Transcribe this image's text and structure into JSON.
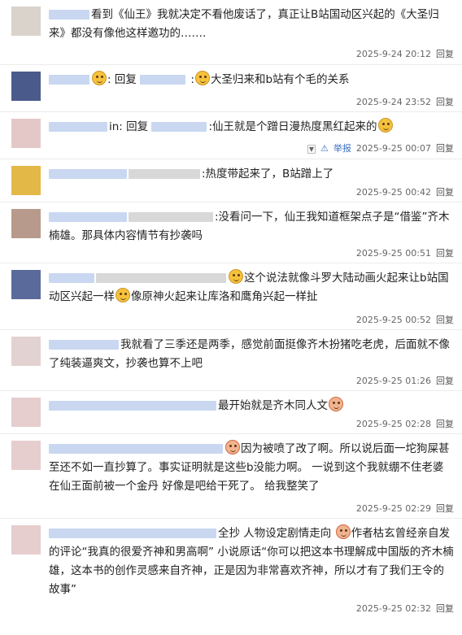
{
  "comments": [
    {
      "parts": [
        {
          "t": "看到《仙王》我就决定不看他废话了，真正让B站国动区兴起的《大圣归来》都没有像他这样邀功的……."
        }
      ],
      "time": "2025-9-24 20:12"
    },
    {
      "parts": [
        {
          "t": ": 回复 "
        },
        {
          "t": " :"
        },
        {
          "t": "大圣归来和b站有个毛的关系"
        }
      ],
      "time": "2025-9-24 23:52"
    },
    {
      "parts": [
        {
          "t": "in: 回复 "
        },
        {
          "t": ":仙王就是个蹭日漫热度黑红起来的"
        }
      ],
      "time": "2025-9-25 00:07",
      "report": "举报"
    },
    {
      "parts": [
        {
          "t": ":热度带起来了，B站蹭上了"
        }
      ],
      "time": "2025-9-25 00:42"
    },
    {
      "parts": [
        {
          "t": ":没看问一下，仙王我知道框架点子是“借鉴”齐木楠雄。那具体内容情节有抄袭吗"
        }
      ],
      "time": "2025-9-25 00:51"
    },
    {
      "parts": [
        {
          "t": "这个说法就像斗罗大陆动画火起来让b站国动区兴起一样"
        },
        {
          "t": "像原神火起来让库洛和鹰角兴起一样扯"
        }
      ],
      "time": "2025-9-25 00:52"
    },
    {
      "parts": [
        {
          "t": "我就看了三季还是两季，感觉前面挺像齐木扮猪吃老虎，后面就不像了纯装逼爽文，抄袭也算不上吧"
        }
      ],
      "time": "2025-9-25 01:26"
    },
    {
      "parts": [
        {
          "t": "最开始就是齐木同人文"
        }
      ],
      "time": "2025-9-25 02:28"
    },
    {
      "parts": [
        {
          "t": "因为被喷了改了啊。所以说后面一坨狗屎甚至还不如一直抄算了。事实证明就是这些b没能力啊。 一说到这个我就绷不住老婆在仙王面前被一个金丹 好像是吧给干死了。 给我整笑了"
        }
      ],
      "time": "2025-9-25 02:29"
    },
    {
      "parts": [
        {
          "t": "全抄 人物设定剧情走向 "
        },
        {
          "t": "作者枯玄曾经亲自发的评论“我真的很爱齐神和男高啊” 小说原话“你可以把这本书理解成中国版的齐木楠雄，这本书的创作灵感来自齐神，正是因为非常喜欢齐神，所以才有了我们王令的故事”"
        }
      ],
      "time": "2025-9-25 02:32"
    }
  ],
  "reply_label": "回复"
}
